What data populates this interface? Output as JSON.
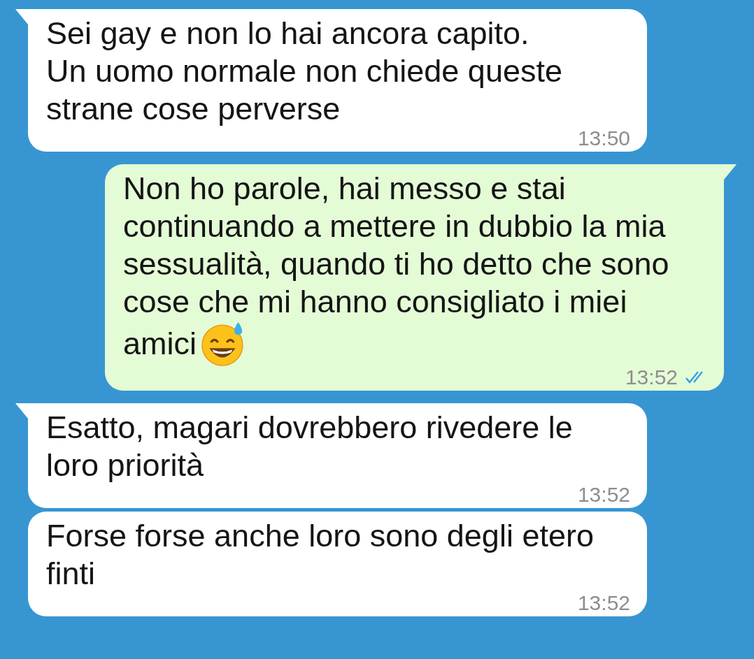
{
  "messages": [
    {
      "kind": "incoming",
      "tail": true,
      "text": "Sei gay e non lo hai ancora capito.\nUn uomo normale non chiede queste strane cose perverse",
      "time": "13:50"
    },
    {
      "kind": "outgoing",
      "tail": true,
      "text": "Non ho parole, hai messo e stai continuando a mettere in dubbio la mia sessualità, quando ti ho detto che sono cose che mi hanno consigliato i miei amici",
      "sweat_smile_emoji": true,
      "time": "13:52",
      "read": true
    },
    {
      "kind": "incoming",
      "tail": true,
      "text": "Esatto, magari dovrebbero rivedere le loro priorità",
      "time": "13:52"
    },
    {
      "kind": "incoming",
      "tail": false,
      "text": "Forse forse anche loro sono degli etero finti",
      "time": "13:52"
    }
  ]
}
